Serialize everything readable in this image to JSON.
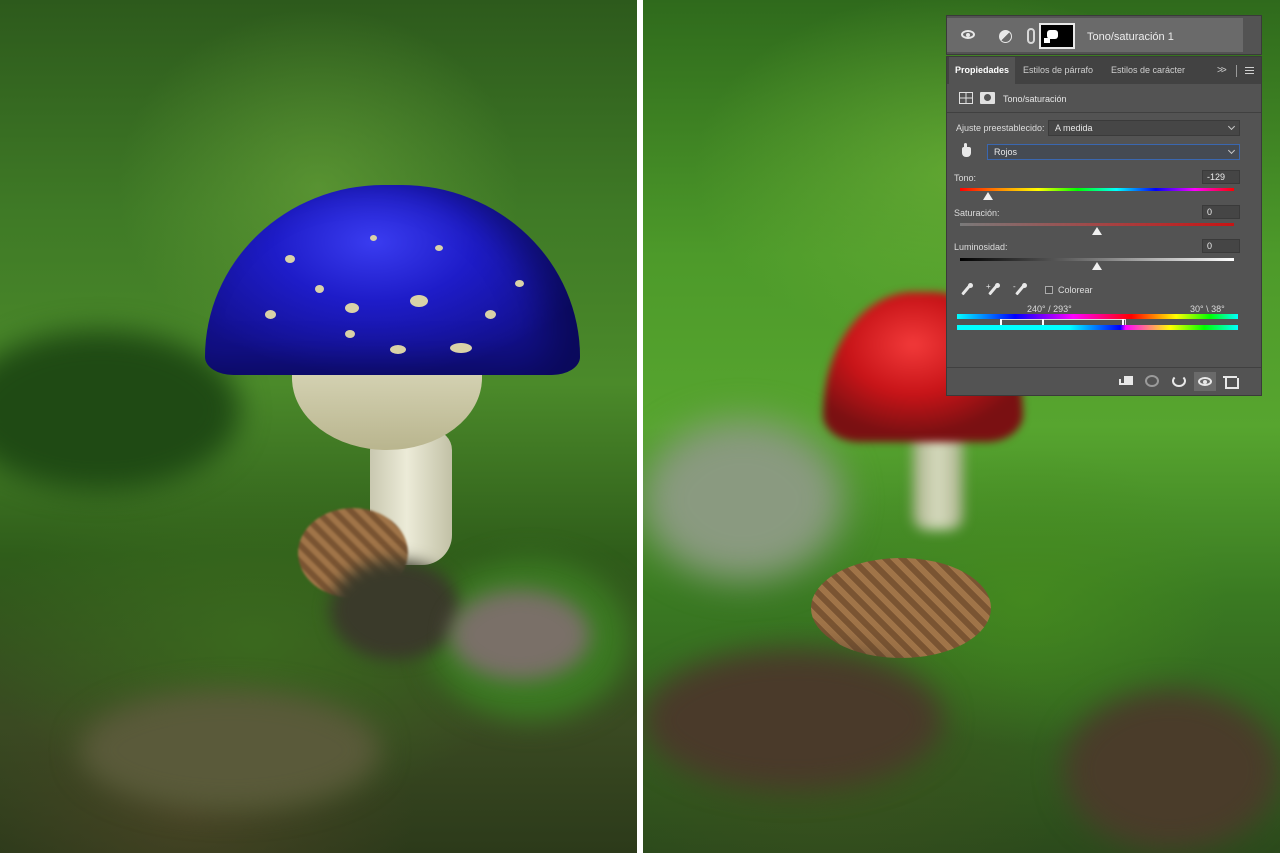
{
  "layers_panel": {
    "layer_name": "Tono/saturación 1"
  },
  "properties": {
    "tabs": [
      {
        "label": "Propiedades",
        "active": true
      },
      {
        "label": "Estilos de párrafo",
        "active": false
      },
      {
        "label": "Estilos de carácter",
        "active": false
      }
    ],
    "more_label": ">>",
    "header_title": "Tono/saturación",
    "preset_label": "Ajuste preestablecido:",
    "preset_value": "A medida",
    "channel_value": "Rojos",
    "hue": {
      "label": "Tono:",
      "value": "-129",
      "slider_fraction": 0.14
    },
    "saturation": {
      "label": "Saturación:",
      "value": "0",
      "slider_fraction": 0.5
    },
    "lightness": {
      "label": "Luminosidad:",
      "value": "0",
      "slider_fraction": 0.5
    },
    "colorize_label": "Colorear",
    "eyedropper_add": "+",
    "eyedropper_subtract": "-",
    "range_left": "240° / 293°",
    "range_right": "30° \\ 38°"
  },
  "colors": {
    "panel_bg": "#535353",
    "tab_bar_bg": "#424242",
    "layer_row_bg": "#6a6a6a",
    "blue_cap": "#1e1cc8",
    "red_cap": "#c81418"
  },
  "icons": {
    "visibility": "eye-icon",
    "adjustment": "adjustment-layer-icon",
    "chain": "link-icon",
    "mask": "mask-thumbnail",
    "tab_menu": "hamburger-menu-icon",
    "targeted_adjustment": "hand-icon",
    "eyedroppers": [
      "eyedropper-icon",
      "eyedropper-add-icon",
      "eyedropper-subtract-icon"
    ],
    "footer": [
      "clip-to-layer-icon",
      "view-previous-icon",
      "reset-icon",
      "eye-icon",
      "trash-icon"
    ]
  }
}
